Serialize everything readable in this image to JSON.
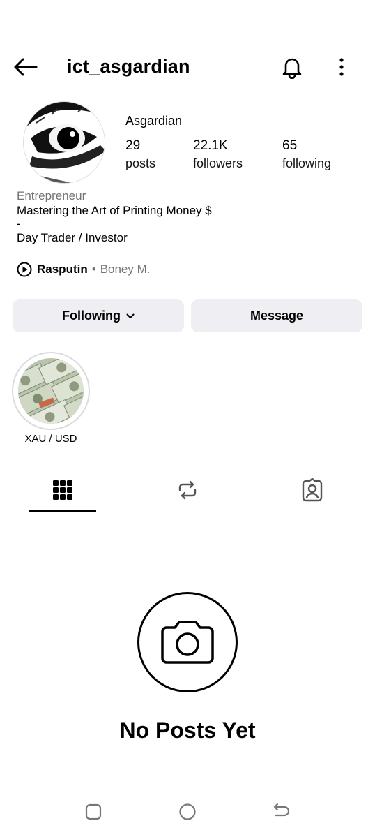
{
  "header": {
    "username": "ict_asgardian",
    "back_icon": "arrow-left-icon",
    "notifications_icon": "bell-icon",
    "more_icon": "more-vertical-icon"
  },
  "profile": {
    "display_name": "Asgardian",
    "avatar_icon": "eye-close-up-avatar",
    "stats": {
      "posts": {
        "value": "29",
        "label": "posts"
      },
      "followers": {
        "value": "22.1K",
        "label": "followers"
      },
      "following": {
        "value": "65",
        "label": "following"
      }
    }
  },
  "bio": {
    "category": "Entrepreneur",
    "line1": "Mastering the Art of Printing Money $",
    "line2": "-",
    "line3": "Day Trader / Investor"
  },
  "music": {
    "song": "Rasputin",
    "separator": "•",
    "artist": "Boney M."
  },
  "actions": {
    "following_label": "Following",
    "message_label": "Message"
  },
  "highlights": [
    {
      "label": "XAU / USD",
      "image": "dollar-bills-image"
    }
  ],
  "tabs": [
    {
      "icon": "grid-icon",
      "active": true
    },
    {
      "icon": "repost-icon",
      "active": false
    },
    {
      "icon": "tagged-person-icon",
      "active": false
    }
  ],
  "empty_state": {
    "icon": "camera-icon",
    "title": "No Posts Yet"
  },
  "system_nav": [
    "recents-icon",
    "home-icon",
    "back-icon"
  ],
  "colors": {
    "secondary_text": "#737373",
    "button_bg": "#efeff3"
  }
}
